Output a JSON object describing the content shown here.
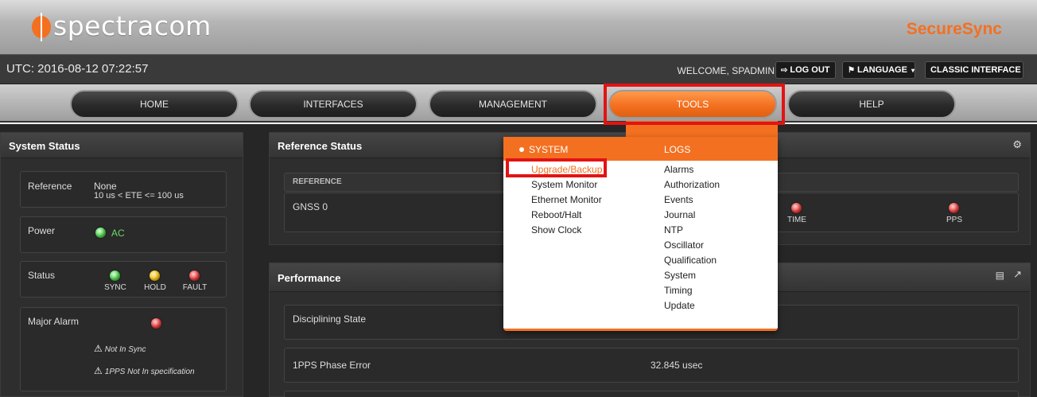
{
  "banner": {
    "logo_text": "spectracom",
    "product_name": "SecureSync"
  },
  "infobar": {
    "utc": "UTC: 2016-08-12 07:22:57",
    "welcome": "WELCOME, SPADMIN",
    "logout": "LOG OUT",
    "language": "LANGUAGE",
    "classic": "CLASSIC INTERFACE"
  },
  "nav": {
    "home": "HOME",
    "interfaces": "INTERFACES",
    "management": "MANAGEMENT",
    "tools": "TOOLS",
    "help": "HELP"
  },
  "system_status": {
    "title": "System Status",
    "reference_label": "Reference",
    "reference_value": "None",
    "reference_ete": "10 us < ETE <= 100 us",
    "power_label": "Power",
    "power_value": "AC",
    "status_label": "Status",
    "status_sync": "SYNC",
    "status_hold": "HOLD",
    "status_fault": "FAULT",
    "major_alarm_label": "Major Alarm",
    "alarm_1": "Not In Sync",
    "alarm_2": "1PPS Not In specification"
  },
  "reference_status": {
    "title": "Reference Status",
    "col_header": "REFERENCE",
    "row_label": "GNSS 0",
    "time_label": "TIME",
    "pps_label": "PPS"
  },
  "performance": {
    "title": "Performance",
    "disciplining_label": "Disciplining State",
    "pps_error_label": "1PPS Phase Error",
    "pps_error_value": "32.845 usec"
  },
  "tools_menu": {
    "system_header": "SYSTEM",
    "logs_header": "LOGS",
    "system_items": [
      "Upgrade/Backup",
      "System Monitor",
      "Ethernet Monitor",
      "Reboot/Halt",
      "Show Clock"
    ],
    "logs_items": [
      "Alarms",
      "Authorization",
      "Events",
      "Journal",
      "NTP",
      "Oscillator",
      "Qualification",
      "System",
      "Timing",
      "Update"
    ]
  },
  "colors": {
    "accent": "#f37021",
    "highlight": "#e31313"
  }
}
